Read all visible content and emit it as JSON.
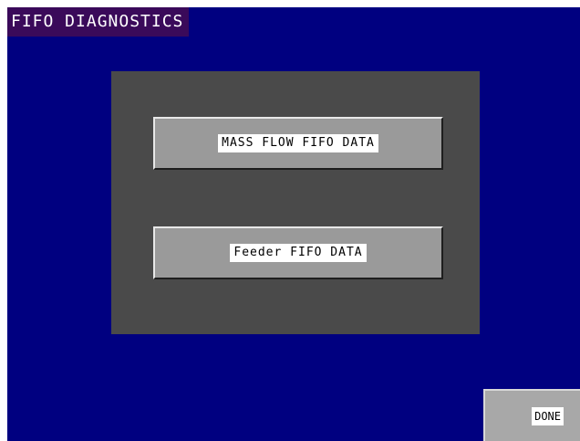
{
  "screen": {
    "title": "FIFO DIAGNOSTICS",
    "background_color": "#000080"
  },
  "panel": {
    "background_color": "#4a4a4a",
    "buttons": [
      {
        "label": "MASS FLOW FIFO DATA"
      },
      {
        "label": "Feeder FIFO DATA"
      }
    ]
  },
  "footer": {
    "done_label": "DONE"
  }
}
